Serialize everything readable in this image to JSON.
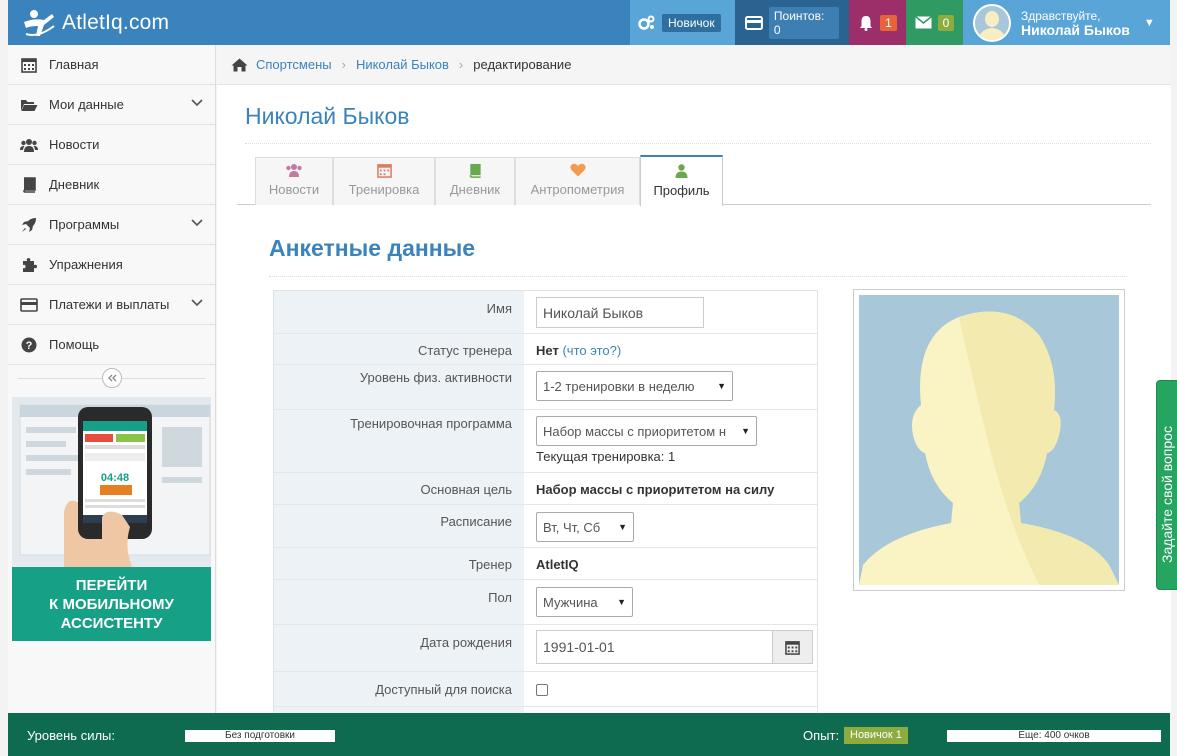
{
  "topbar": {
    "brand": "AtletIq.com",
    "rank_label": "Новичок",
    "points_label": "Поинтов: 0",
    "notifications_count": "1",
    "messages_count": "0",
    "greeting": "Здравствуйте,",
    "user_name": "Николай Быков",
    "colors": {
      "bar": "#3a83bc",
      "notif": "#9c2e6a",
      "mail": "#2f9a62",
      "points": "#2b6390"
    }
  },
  "sidebar": {
    "items": [
      {
        "label": "Главная",
        "icon": "calendar-icon"
      },
      {
        "label": "Мои данные",
        "icon": "folder-open-icon"
      },
      {
        "label": "Новости",
        "icon": "users-icon"
      },
      {
        "label": "Дневник",
        "icon": "book-icon"
      },
      {
        "label": "Программы",
        "icon": "rocket-icon"
      },
      {
        "label": "Упражнения",
        "icon": "puzzle-icon"
      },
      {
        "label": "Платежи и выплаты",
        "icon": "credit-card-icon"
      },
      {
        "label": "Помощь",
        "icon": "question-circle-icon"
      }
    ],
    "promo": {
      "lines": [
        "ПЕРЕЙТИ",
        "К МОБИЛЬНОМУ",
        "АССИСТЕНТУ"
      ],
      "phone_time": "04:48"
    }
  },
  "breadcrumb": {
    "root": "Спортсмены",
    "person": "Николай Быков",
    "current": "редактирование"
  },
  "page_title": "Николай Быков",
  "tabs": [
    {
      "label": "Новости",
      "icon": "users-icon",
      "color": "#c27ba0"
    },
    {
      "label": "Тренировка",
      "icon": "calendar-icon",
      "color": "#e07a5f"
    },
    {
      "label": "Дневник",
      "icon": "book-icon",
      "color": "#6aa84f"
    },
    {
      "label": "Антропометрия",
      "icon": "heart-icon",
      "color": "#f39c4f"
    },
    {
      "label": "Профиль",
      "icon": "user-icon",
      "color": "#6aa84f"
    }
  ],
  "section_title": "Анкетные данные",
  "form": {
    "name": {
      "label": "Имя",
      "value": "Николай Быков"
    },
    "trainer_status": {
      "label": "Статус тренера",
      "value": "Нет",
      "link_open": "(",
      "link": "что это?",
      "link_close": ")"
    },
    "activity": {
      "label": "Уровень физ. активности",
      "value": "1-2 тренировки в неделю"
    },
    "program": {
      "label": "Тренировочная программа",
      "value": "Набор массы с приоритетом н",
      "current": "Текущая тренировка: 1"
    },
    "goal": {
      "label": "Основная цель",
      "value": "Набор массы с приоритетом на силу"
    },
    "schedule": {
      "label": "Расписание",
      "value": "Вт, Чт, Сб"
    },
    "trainer": {
      "label": "Тренер",
      "value": "AtletIQ"
    },
    "gender": {
      "label": "Пол",
      "value": "Мужчина"
    },
    "birthdate": {
      "label": "Дата рождения",
      "value": "1991-01-01"
    },
    "searchable": {
      "label": "Доступный для поиска"
    }
  },
  "ask_question": "Задайте свой вопрос",
  "footer": {
    "strength_label": "Уровень силы:",
    "strength_value": "Без подготовки",
    "exp_label": "Опыт:",
    "exp_badge": "Новичок 1",
    "remaining": "Еще: 400 очков"
  }
}
